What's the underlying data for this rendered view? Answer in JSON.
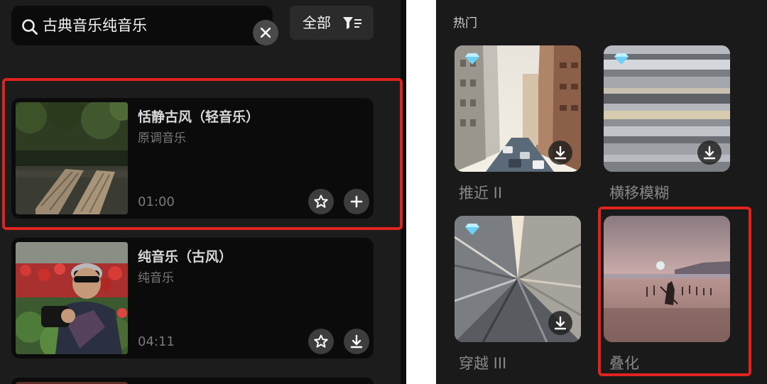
{
  "search": {
    "query": "古典音乐纯音乐"
  },
  "filter": {
    "label": "全部"
  },
  "tracks": [
    {
      "title": "恬静古风（轻音乐）",
      "subtitle": "原调音乐",
      "duration": "01:00"
    },
    {
      "title": "纯音乐（古风）",
      "subtitle": "纯音乐",
      "duration": "04:11"
    }
  ],
  "transitions": {
    "section_title": "热门",
    "items": [
      {
        "label": "推近 II"
      },
      {
        "label": "横移模糊"
      },
      {
        "label": "穿越 III"
      },
      {
        "label": "叠化"
      }
    ]
  },
  "colors": {
    "highlight": "#e0231c",
    "panel": "#1c1c1c",
    "card": "#0b0b0b"
  }
}
